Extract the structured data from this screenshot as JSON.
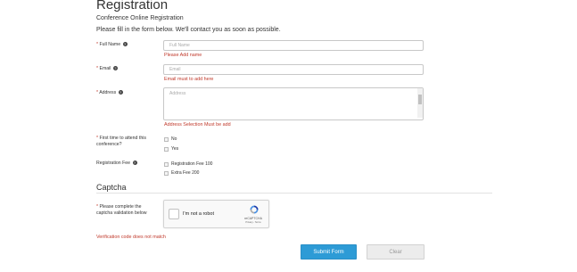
{
  "header": {
    "title": "Registration",
    "subtitle": "Conference Online Registration",
    "intro": "Please fill in the form below. We'll contact you as soon as possible."
  },
  "form": {
    "required_mark": "*",
    "help_glyph": "?",
    "full_name": {
      "label": "Full Name",
      "placeholder": "Full Name",
      "error": "Please Add name"
    },
    "email": {
      "label": "Email",
      "placeholder": "Email",
      "error": "Email must to add here"
    },
    "address": {
      "label": "Address",
      "placeholder": "Address",
      "error": "Address Selection Must be add"
    },
    "first_time": {
      "label": "First time to attend this conference?",
      "options": [
        "No",
        "Yes"
      ]
    },
    "registration_fee": {
      "label": "Registration Fee",
      "options": [
        "Registration Fee 100",
        "Extra Fee 200"
      ]
    }
  },
  "captcha": {
    "heading": "Captcha",
    "label": "Please complete the captcha validation below",
    "widget_text": "I'm not a robot",
    "brand": "reCAPTCHA",
    "links": "Privacy - Terms",
    "error": "Verification code does not match"
  },
  "actions": {
    "submit_label": "Submit Form",
    "clear_label": "Clear"
  },
  "colors": {
    "primary": "#2d9bd6",
    "error": "#c0392b",
    "clear_bg": "#ececec"
  }
}
